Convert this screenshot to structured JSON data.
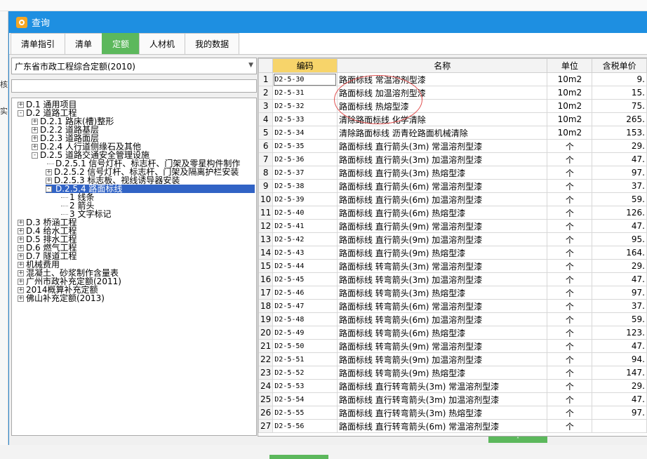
{
  "background": {
    "left_fragments": [
      "核",
      "实"
    ]
  },
  "window": {
    "title": "查询",
    "accent": "#1e8fe1",
    "active_tab_color": "#5cb85c"
  },
  "tabs": [
    "清单指引",
    "清单",
    "定额",
    "人材机",
    "我的数据"
  ],
  "active_tab": "定额",
  "left": {
    "library_select": "广东省市政工程综合定额(2010)",
    "search_value": "",
    "tree": [
      {
        "label": "D.1 通用项目",
        "toggle": "+"
      },
      {
        "label": "D.2 道路工程",
        "toggle": "-"
      },
      {
        "label": "D.2.1 路床(槽)整形",
        "toggle": "+"
      },
      {
        "label": "D.2.2 道路基层",
        "toggle": "+"
      },
      {
        "label": "D.2.3 道路面层",
        "toggle": "+"
      },
      {
        "label": "D.2.4 人行道侧缘石及其他",
        "toggle": "+"
      },
      {
        "label": "D.2.5 道路交通安全管理设施",
        "toggle": "-"
      },
      {
        "label": "D.2.5.1 信号灯杆、标志杆、门架及零星构件制作",
        "toggle": ""
      },
      {
        "label": "D.2.5.2 信号灯杆、标志杆、门架及隔离护栏安装",
        "toggle": "+"
      },
      {
        "label": "D.2.5.3 标志板、视线诱导器安装",
        "toggle": "+"
      },
      {
        "label": "D.2.5.4 路面标线",
        "toggle": "-"
      },
      {
        "label": "1 线条",
        "toggle": ""
      },
      {
        "label": "2 箭头",
        "toggle": ""
      },
      {
        "label": "3 文字标记",
        "toggle": ""
      },
      {
        "label": "D.3 桥涵工程",
        "toggle": "+"
      },
      {
        "label": "D.4 给水工程",
        "toggle": "+"
      },
      {
        "label": "D.5 排水工程",
        "toggle": "+"
      },
      {
        "label": "D.6 燃气工程",
        "toggle": "+"
      },
      {
        "label": "D.7 隧道工程",
        "toggle": "+"
      },
      {
        "label": "机械费用",
        "toggle": "+"
      },
      {
        "label": "混凝土、砂浆制作含量表",
        "toggle": "+"
      },
      {
        "label": "广州市政补充定额(2011)",
        "toggle": "+"
      },
      {
        "label": "2014概算补充定额",
        "toggle": "+"
      },
      {
        "label": "佛山补充定额(2013)",
        "toggle": "+"
      }
    ]
  },
  "table": {
    "headers": [
      "",
      "编码",
      "名称",
      "单位",
      "含税单价"
    ],
    "rows": [
      [
        "1",
        "D2-5-30",
        "路面标线 常温溶剂型漆",
        "10m2",
        "9."
      ],
      [
        "2",
        "D2-5-31",
        "路面标线 加温溶剂型漆",
        "10m2",
        "15."
      ],
      [
        "3",
        "D2-5-32",
        "路面标线 热熔型漆",
        "10m2",
        "75."
      ],
      [
        "4",
        "D2-5-33",
        "清除路面标线 化学清除",
        "10m2",
        "265."
      ],
      [
        "5",
        "D2-5-34",
        "清除路面标线 沥青砼路面机械清除",
        "10m2",
        "153."
      ],
      [
        "6",
        "D2-5-35",
        "路面标线 直行箭头(3m) 常温溶剂型漆",
        "个",
        "29."
      ],
      [
        "7",
        "D2-5-36",
        "路面标线 直行箭头(3m) 加温溶剂型漆",
        "个",
        "47."
      ],
      [
        "8",
        "D2-5-37",
        "路面标线 直行箭头(3m) 热熔型漆",
        "个",
        "97."
      ],
      [
        "9",
        "D2-5-38",
        "路面标线 直行箭头(6m) 常温溶剂型漆",
        "个",
        "37."
      ],
      [
        "10",
        "D2-5-39",
        "路面标线 直行箭头(6m) 加温溶剂型漆",
        "个",
        "59."
      ],
      [
        "11",
        "D2-5-40",
        "路面标线 直行箭头(6m) 热熔型漆",
        "个",
        "126."
      ],
      [
        "12",
        "D2-5-41",
        "路面标线 直行箭头(9m) 常温溶剂型漆",
        "个",
        "47."
      ],
      [
        "13",
        "D2-5-42",
        "路面标线 直行箭头(9m) 加温溶剂型漆",
        "个",
        "95."
      ],
      [
        "14",
        "D2-5-43",
        "路面标线 直行箭头(9m) 热熔型漆",
        "个",
        "164."
      ],
      [
        "15",
        "D2-5-44",
        "路面标线 转弯箭头(3m) 常温溶剂型漆",
        "个",
        "29."
      ],
      [
        "16",
        "D2-5-45",
        "路面标线 转弯箭头(3m) 加温溶剂型漆",
        "个",
        "47."
      ],
      [
        "17",
        "D2-5-46",
        "路面标线 转弯箭头(3m) 热熔型漆",
        "个",
        "97."
      ],
      [
        "18",
        "D2-5-47",
        "路面标线 转弯箭头(6m) 常温溶剂型漆",
        "个",
        "37."
      ],
      [
        "19",
        "D2-5-48",
        "路面标线 转弯箭头(6m) 加温溶剂型漆",
        "个",
        "59."
      ],
      [
        "20",
        "D2-5-49",
        "路面标线 转弯箭头(6m) 热熔型漆",
        "个",
        "123."
      ],
      [
        "21",
        "D2-5-50",
        "路面标线 转弯箭头(9m) 常温溶剂型漆",
        "个",
        "47."
      ],
      [
        "22",
        "D2-5-51",
        "路面标线 转弯箭头(9m) 加温溶剂型漆",
        "个",
        "94."
      ],
      [
        "23",
        "D2-5-52",
        "路面标线 转弯箭头(9m) 热熔型漆",
        "个",
        "147."
      ],
      [
        "24",
        "D2-5-53",
        "路面标线 直行转弯箭头(3m) 常温溶剂型漆",
        "个",
        "29."
      ],
      [
        "25",
        "D2-5-54",
        "路面标线 直行转弯箭头(3m) 加温溶剂型漆",
        "个",
        "47."
      ],
      [
        "26",
        "D2-5-55",
        "路面标线 直行转弯箭头(3m) 热熔型漆",
        "个",
        "97."
      ],
      [
        "27",
        "D2-5-56",
        "路面标线 直行转弯箭头(6m) 常温溶剂型漆",
        "个",
        ""
      ]
    ]
  },
  "icons": {
    "scroll_up": "˄",
    "scroll_down": "˅"
  }
}
